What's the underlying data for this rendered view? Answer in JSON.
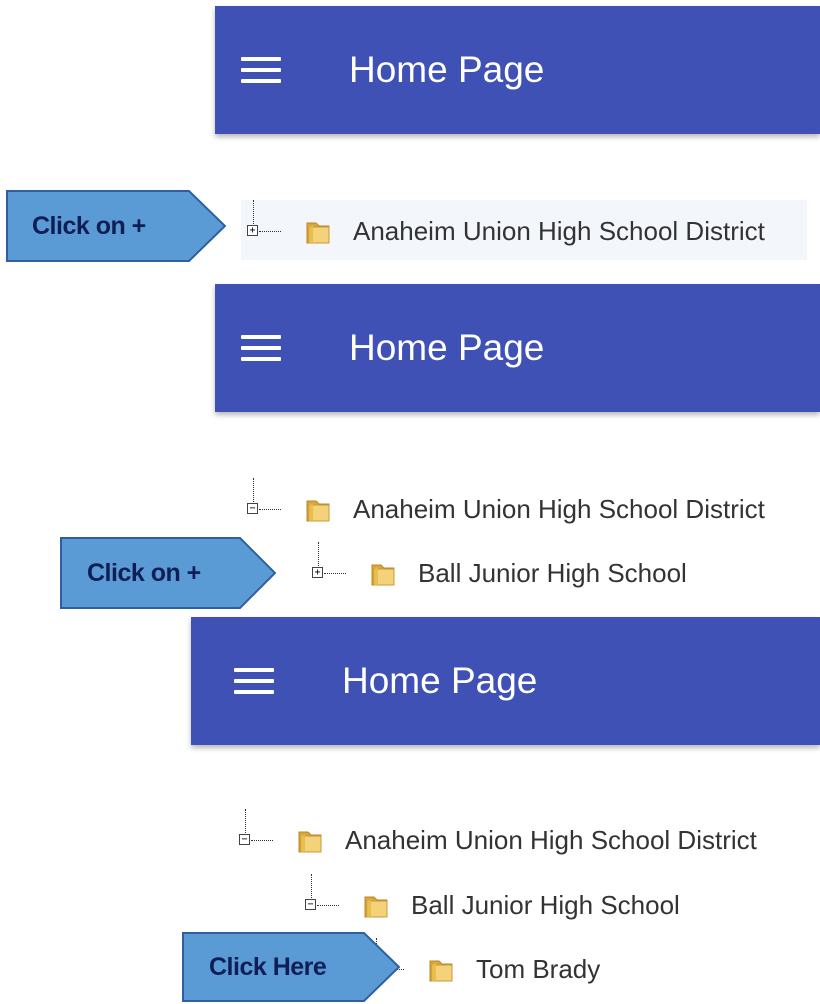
{
  "panels": [
    {
      "appbar": {
        "title": "Home Page"
      },
      "nodes": [
        {
          "label": "Anaheim Union High School District",
          "toggle": "+"
        }
      ],
      "callout": {
        "label": "Click on +"
      }
    },
    {
      "appbar": {
        "title": "Home Page"
      },
      "nodes": [
        {
          "label": "Anaheim Union High School District",
          "toggle": "−"
        },
        {
          "label": "Ball Junior High School",
          "toggle": "+"
        }
      ],
      "callout": {
        "label": "Click on +"
      }
    },
    {
      "appbar": {
        "title": "Home Page"
      },
      "nodes": [
        {
          "label": "Anaheim Union High School District",
          "toggle": "−"
        },
        {
          "label": "Ball Junior High School",
          "toggle": "−"
        },
        {
          "label": "Tom Brady"
        }
      ],
      "callout": {
        "label": "Click Here"
      }
    }
  ],
  "colors": {
    "appbar": "#3f51b5",
    "callout_fill": "#5b9bd5",
    "callout_border": "#2e5fa0",
    "callout_text": "#0f1e56",
    "folder": "#e7bb4a"
  },
  "icons": {
    "menu": "hamburger-menu-icon",
    "folder": "folder-icon",
    "expand": "plus-box-icon",
    "collapse": "minus-box-icon"
  }
}
